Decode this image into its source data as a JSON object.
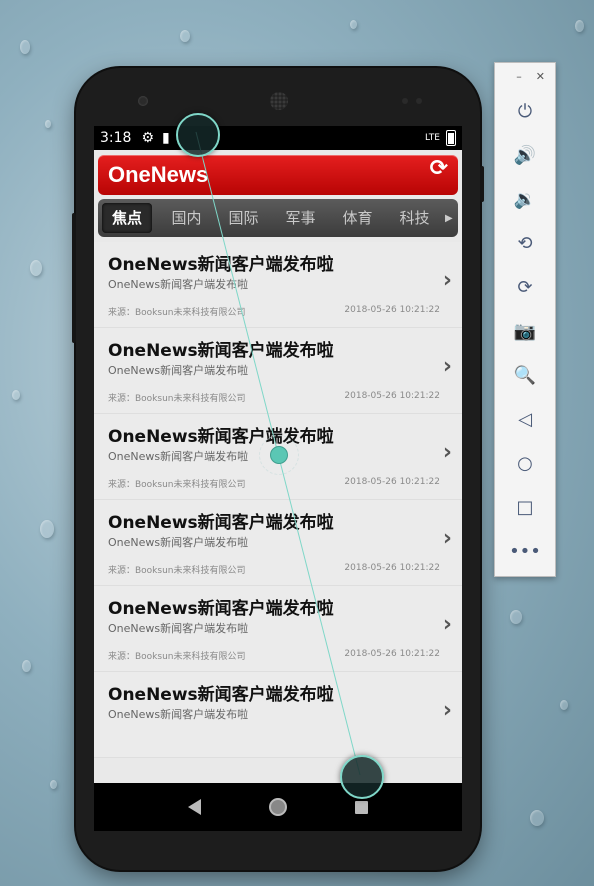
{
  "status": {
    "time": "3:18",
    "network": "LTE"
  },
  "app": {
    "title": "OneNews",
    "refresh_icon": "refresh-icon"
  },
  "tabs": [
    "焦点",
    "国内",
    "国际",
    "军事",
    "体育",
    "科技"
  ],
  "news": [
    {
      "title": "OneNews新闻客户端发布啦",
      "subtitle": "OneNews新闻客户端发布啦",
      "source": "来源：Booksun未来科技有限公司",
      "time": "2018-05-26 10:21:22"
    },
    {
      "title": "OneNews新闻客户端发布啦",
      "subtitle": "OneNews新闻客户端发布啦",
      "source": "来源：Booksun未来科技有限公司",
      "time": "2018-05-26 10:21:22"
    },
    {
      "title": "OneNews新闻客户端发布啦",
      "subtitle": "OneNews新闻客户端发布啦",
      "source": "来源：Booksun未来科技有限公司",
      "time": "2018-05-26 10:21:22"
    },
    {
      "title": "OneNews新闻客户端发布啦",
      "subtitle": "OneNews新闻客户端发布啦",
      "source": "来源：Booksun未来科技有限公司",
      "time": "2018-05-26 10:21:22"
    },
    {
      "title": "OneNews新闻客户端发布啦",
      "subtitle": "OneNews新闻客户端发布啦",
      "source": "来源：Booksun未来科技有限公司",
      "time": "2018-05-26 10:21:22"
    },
    {
      "title": "OneNews新闻客户端发布啦",
      "subtitle": "OneNews新闻客户端发布啦",
      "source": "",
      "time": ""
    }
  ],
  "toolbar": {
    "icons": [
      "power-icon",
      "volume-up-icon",
      "volume-down-icon",
      "rotate-left-icon",
      "rotate-right-icon",
      "camera-icon",
      "zoom-icon",
      "back-icon",
      "home-icon",
      "overview-icon",
      "more-icon"
    ]
  },
  "colors": {
    "accent": "#d40d0d",
    "tab_bg": "#4a4a4a",
    "touch": "#5bc7b4"
  }
}
